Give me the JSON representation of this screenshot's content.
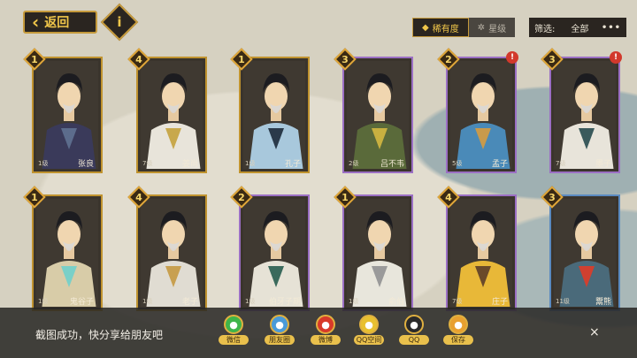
{
  "header": {
    "back_label": "返回",
    "info_label": "i",
    "sort_tabs": [
      {
        "label": "稀有度",
        "icon": "diamond-icon",
        "active": true
      },
      {
        "label": "星级",
        "icon": "star-outline-icon",
        "active": false
      }
    ],
    "filter_label": "筛选:",
    "filter_value": "全部",
    "more_label": "•••"
  },
  "cards": [
    {
      "name": "张良",
      "level": "1级",
      "stars": "1",
      "frame": "gold",
      "alert": false,
      "robe": "#3a3a5a",
      "accent": "#5c6c8c"
    },
    {
      "name": "姜尚",
      "level": "7级",
      "stars": "4",
      "frame": "gold",
      "alert": false,
      "robe": "#e8e4da",
      "accent": "#c8a84c"
    },
    {
      "name": "孔子",
      "level": "1级",
      "stars": "1",
      "frame": "gold",
      "alert": false,
      "robe": "#a8c8dc",
      "accent": "#2a3a4a"
    },
    {
      "name": "吕不韦",
      "level": "2级",
      "stars": "3",
      "frame": "purple",
      "alert": false,
      "robe": "#5a6a3a",
      "accent": "#c8b040"
    },
    {
      "name": "孟子",
      "level": "5级",
      "stars": "2",
      "frame": "purple",
      "alert": true,
      "robe": "#4a8ab8",
      "accent": "#c89a4c"
    },
    {
      "name": "墨子",
      "level": "7级",
      "stars": "3",
      "frame": "purple",
      "alert": true,
      "robe": "#e8e4da",
      "accent": "#3a5a5c"
    },
    {
      "name": "鬼谷子",
      "level": "1级",
      "stars": "1",
      "frame": "gold",
      "alert": false,
      "robe": "#d8cca8",
      "accent": "#7ad0c8"
    },
    {
      "name": "老子",
      "level": "1级",
      "stars": "4",
      "frame": "gold",
      "alert": false,
      "robe": "#e0dcd2",
      "accent": "#c8a050"
    },
    {
      "name": "伯牙子期",
      "level": "1级",
      "stars": "2",
      "frame": "purple",
      "alert": false,
      "robe": "#e6e2d6",
      "accent": "#3a6a5c"
    },
    {
      "name": "俞伯",
      "level": "1级",
      "stars": "1",
      "frame": "purple",
      "alert": false,
      "robe": "#e8e6dc",
      "accent": "#9a9a9a"
    },
    {
      "name": "庄子",
      "level": "7级",
      "stars": "4",
      "frame": "purple",
      "alert": false,
      "robe": "#e8b838",
      "accent": "#6a4a2a"
    },
    {
      "name": "鬻熊",
      "level": "11级",
      "stars": "3",
      "frame": "blue",
      "alert": false,
      "robe": "#4a6a7a",
      "accent": "#d04030"
    }
  ],
  "share": {
    "message": "截图成功，快分享给朋友吧",
    "items": [
      {
        "label": "微信",
        "icon": "wechat-icon",
        "color": "#3fb54a"
      },
      {
        "label": "朋友圈",
        "icon": "moments-icon",
        "color": "#4a9ad8"
      },
      {
        "label": "微博",
        "icon": "weibo-icon",
        "color": "#d83a2a"
      },
      {
        "label": "QQ空间",
        "icon": "qzone-icon",
        "color": "#e8c030"
      },
      {
        "label": "QQ",
        "icon": "qq-icon",
        "color": "#2a2a2a"
      },
      {
        "label": "保存",
        "icon": "save-icon",
        "color": "#e8a030"
      }
    ],
    "close_label": "×"
  }
}
